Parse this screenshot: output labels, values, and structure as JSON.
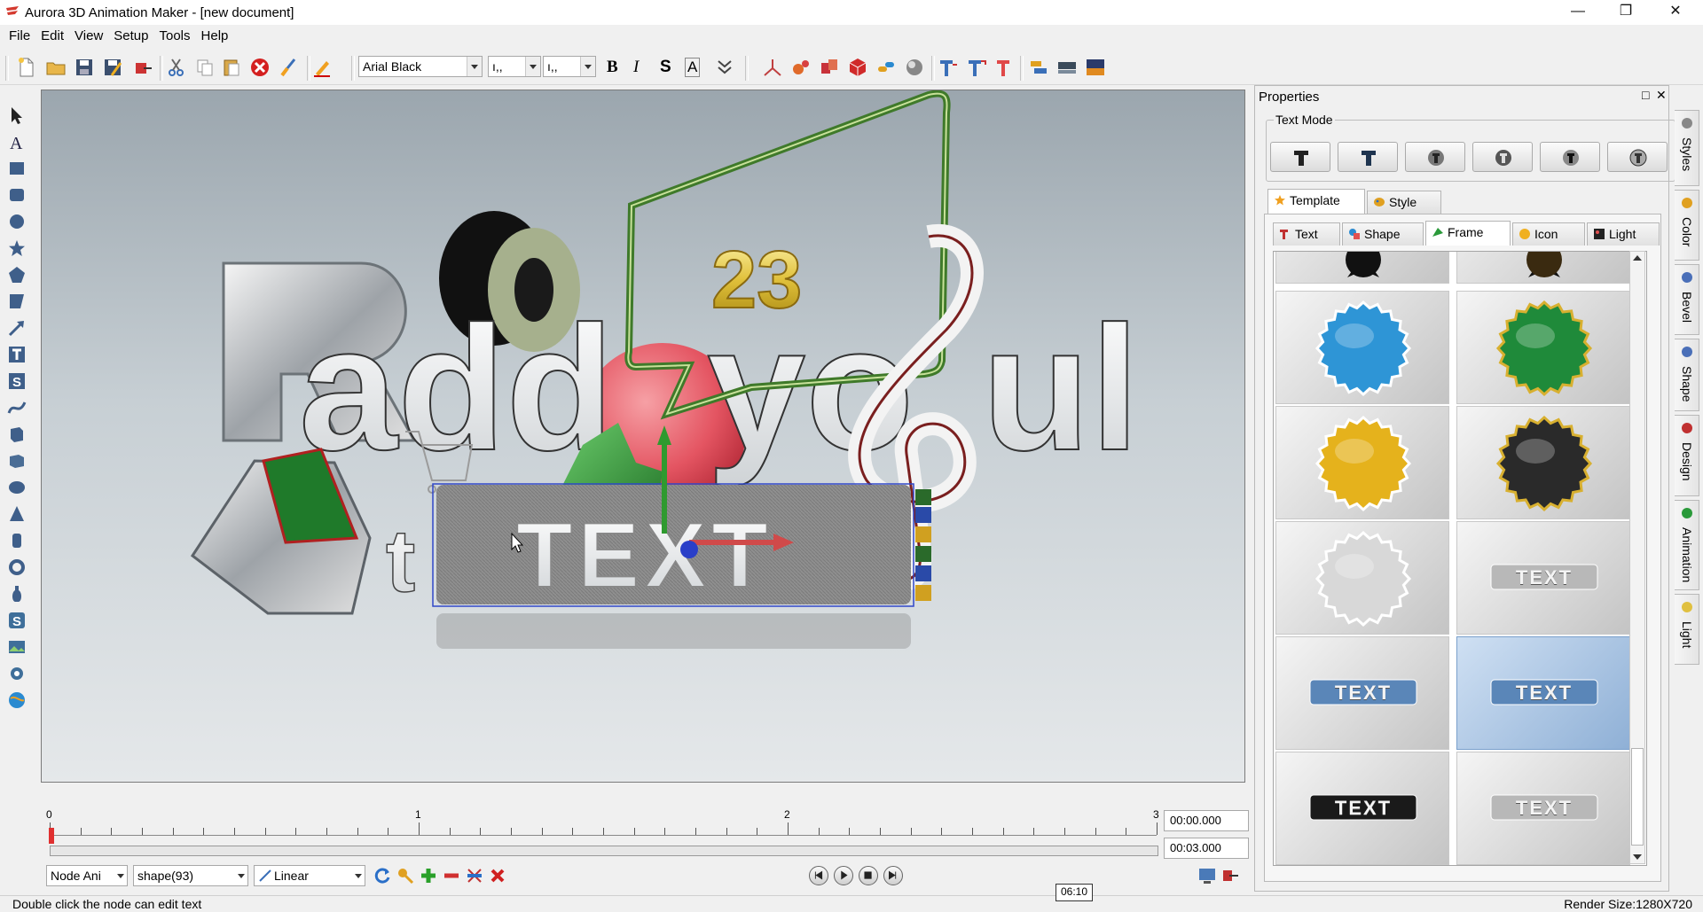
{
  "window": {
    "title": "Aurora 3D Animation Maker - [new document]"
  },
  "menu": [
    "File",
    "Edit",
    "View",
    "Setup",
    "Tools",
    "Help"
  ],
  "toolbar": {
    "font": "Arial Black",
    "size1": "ı,,",
    "size2": "ı,,"
  },
  "timeline": {
    "ticks": [
      "0",
      "1",
      "2",
      "3"
    ],
    "current_time": "00:00.000",
    "total_time": "00:03.000"
  },
  "controls": {
    "mode": "Node Ani",
    "node": "shape(93)",
    "interpolation": "Linear"
  },
  "status": {
    "hint": "Double click the node can edit text",
    "render_size": "Render Size:1280X720",
    "tooltip": "06:10"
  },
  "properties": {
    "title": "Properties",
    "text_mode_label": "Text Mode",
    "main_tabs": [
      "Template",
      "Style"
    ],
    "sub_tabs": [
      "Text",
      "Shape",
      "Frame",
      "Icon",
      "Light"
    ],
    "selected_sub_tab": "Frame",
    "thumbnails": [
      {
        "name": "blue-seal",
        "color": "#2e95d6"
      },
      {
        "name": "green-seal",
        "color": "#1f8a3a"
      },
      {
        "name": "yellow-seal",
        "color": "#e5b21c"
      },
      {
        "name": "black-seal",
        "color": "#2a2a2a"
      },
      {
        "name": "silver-seal",
        "color": "#d8d8d8"
      },
      {
        "name": "text-silver-frame",
        "label": "TEXT"
      },
      {
        "name": "text-blue-frame",
        "label": "TEXT"
      },
      {
        "name": "text-blue-selected",
        "label": "TEXT"
      },
      {
        "name": "text-dark-frame",
        "label": "TEXT"
      },
      {
        "name": "text-glitter-frame",
        "label": "TEXT"
      }
    ]
  },
  "side_tabs": [
    "Styles",
    "Color",
    "Bevel",
    "Shape",
    "Design",
    "Animation",
    "Light"
  ],
  "scene": {
    "main_text": "TEXT",
    "number_badge": "23"
  }
}
